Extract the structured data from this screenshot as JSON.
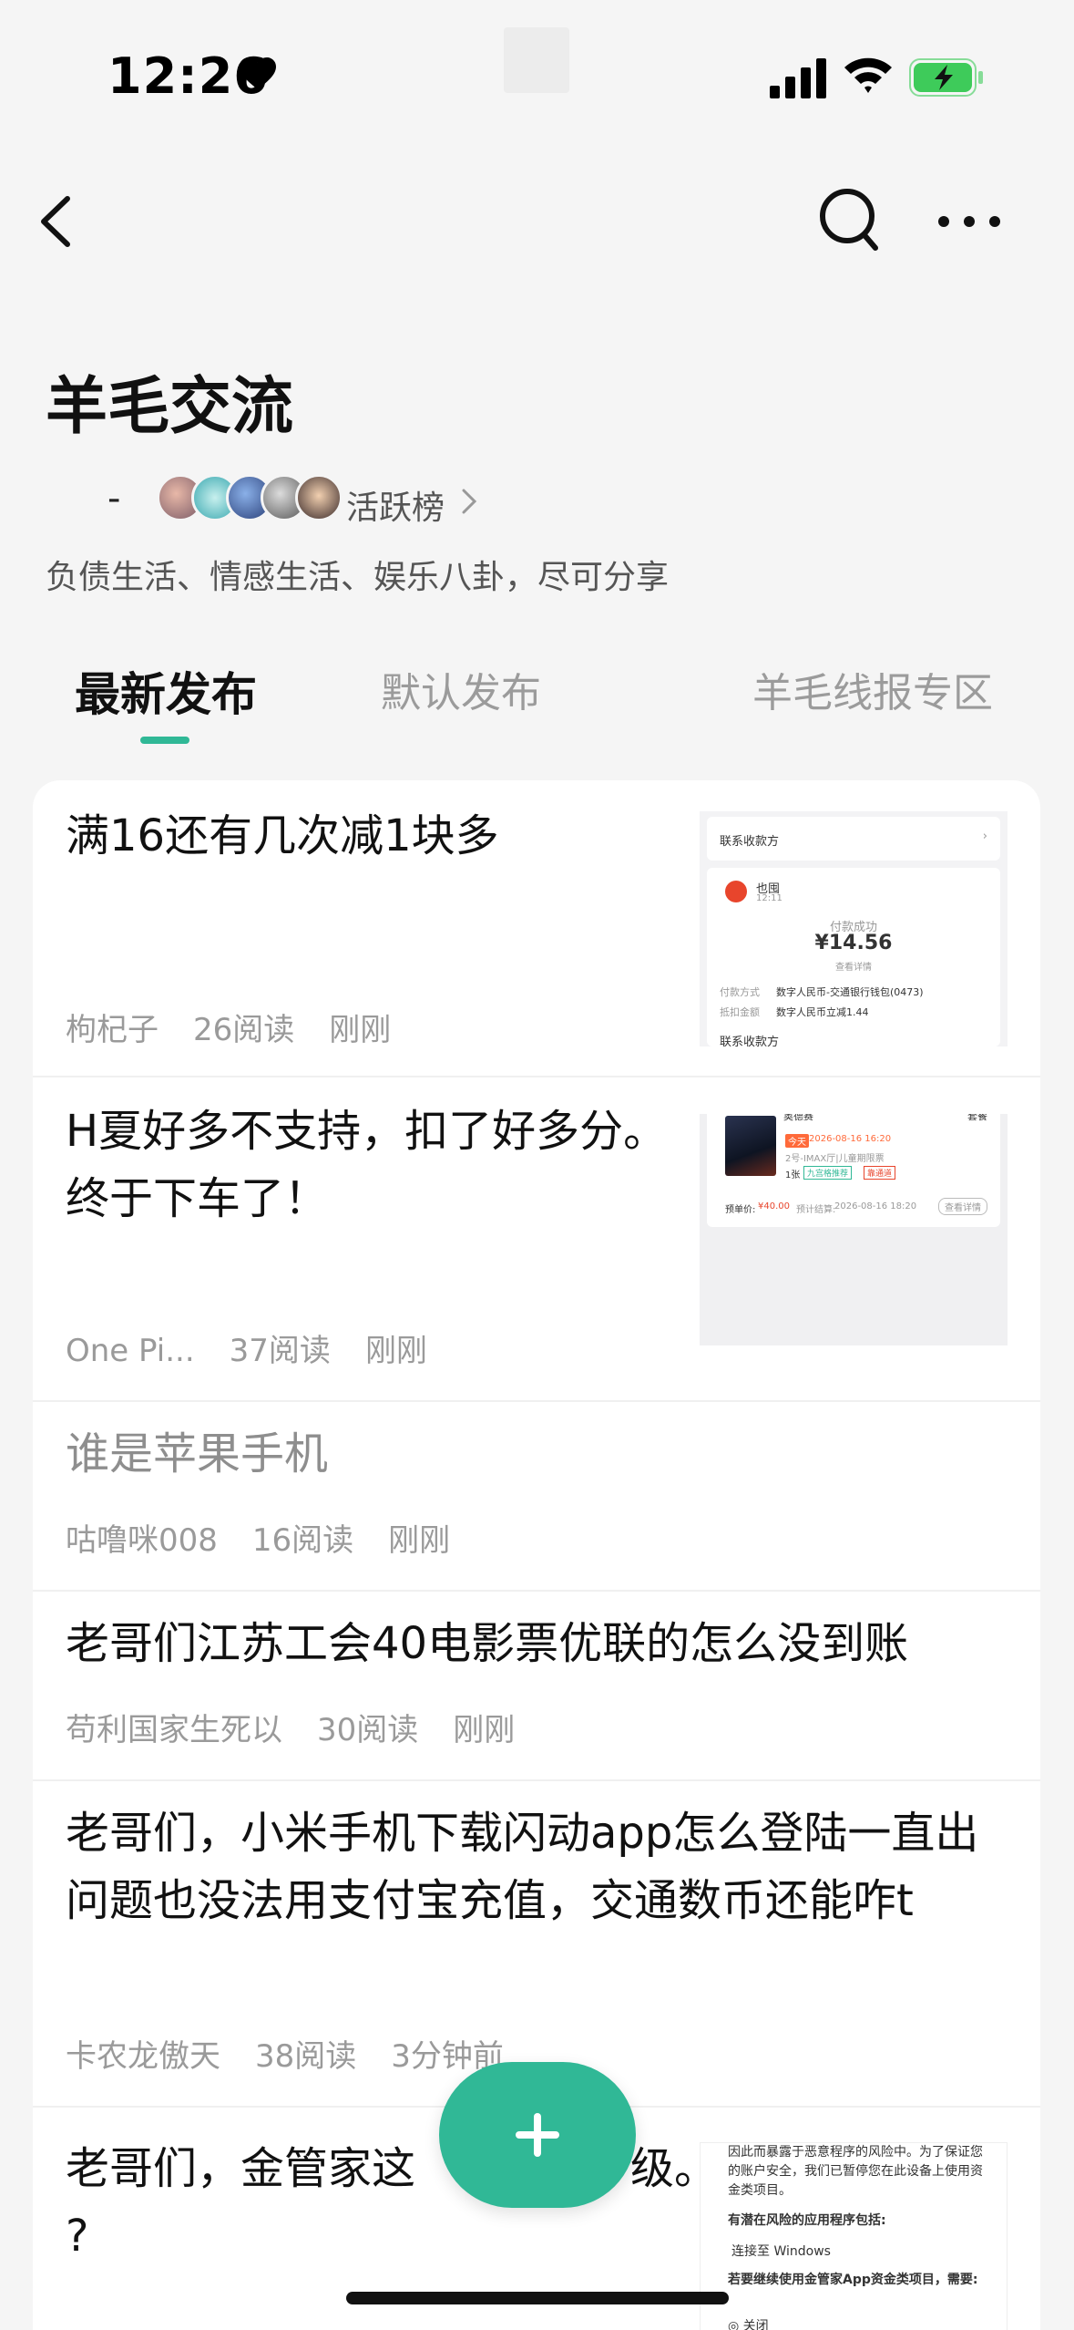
{
  "status_bar": {
    "time": "12:26"
  },
  "header": {
    "title": "羊毛交流",
    "dash": "-",
    "active_label": "活跃榜",
    "description": "负债生活、情感生活、娱乐八卦，尽可分享"
  },
  "tabs": [
    {
      "label": "最新发布",
      "active": true
    },
    {
      "label": "默认发布",
      "active": false
    },
    {
      "label": "羊毛线报专区",
      "active": false
    }
  ],
  "posts": [
    {
      "title": "满16还有几次减1块多",
      "author": "枸杞子",
      "reads": "26阅读",
      "time": "刚刚",
      "thumbnail": {
        "payee_label": "联系收款方",
        "merchant": "也囤",
        "merchant_time": "12:11",
        "status": "付款成功",
        "amount": "¥14.56",
        "detail_link": "查看详情",
        "pay_method_label": "付款方式",
        "pay_method_value": "数字人民币-交通银行钱包(0473)",
        "discount_label": "抵扣金额",
        "discount_value": "数字人民币立减1.44",
        "bottom_label": "联系收款方"
      }
    },
    {
      "title": "H夏好多不支持，扣了好多分。终于下车了！",
      "author": "One Pi...",
      "reads": "37阅读",
      "time": "刚刚",
      "thumbnail": {
        "header_left": "奥德赛",
        "header_right": "套餐",
        "line1_tag": "今天",
        "line1_time": "2026-08-16 16:20",
        "line2": "2号-IMAX厅|儿童期限票",
        "line3_count": "1张",
        "line3_tag1": "九宫格推荐",
        "line3_tag2": "靠通道",
        "price_label": "预单价:",
        "price_value": "¥40.00",
        "expected_label": "预计结算:",
        "expected_value": "2026-08-16 18:20",
        "button": "查看详情"
      }
    },
    {
      "title": "谁是苹果手机",
      "read": true,
      "author": "咕噜咪008",
      "reads": "16阅读",
      "time": "刚刚"
    },
    {
      "title": "老哥们江苏工会40电影票优联的怎么没到账",
      "author": "苟利国家生死以",
      "reads": "30阅读",
      "time": "刚刚"
    },
    {
      "title": "老哥们，小米手机下载闪动app怎么登陆一直出问题也没法用支付宝充值，交通数币还能咋t",
      "author": "卡农龙傲天",
      "reads": "38阅读",
      "time": "3分钟前"
    },
    {
      "title": "老哥们，金管家这",
      "title_tail": "级。",
      "title_line2": "?",
      "thumbnail": {
        "p1": "因此而暴露于恶意程序的风险中。为了保证您的账户安全，我们已暂停您在此设备上使用资金类项目。",
        "h1": "有潜在风险的应用程序包括:",
        "item1": "连接至 Windows",
        "h2": "若要继续使用金管家App资金类项目，需要:",
        "item2": "◎ 关闭"
      }
    }
  ],
  "colors": {
    "accent": "#30b896",
    "background": "#f5f5f5",
    "card": "#ffffff",
    "muted_text": "#9a9a9a",
    "battery_fill": "#3ecb5a"
  },
  "icons": [
    "heart-icon",
    "signal-icon",
    "wifi-icon",
    "battery-charging-icon",
    "back-chevron-icon",
    "search-icon",
    "more-icon",
    "chevron-right-icon",
    "plus-icon"
  ]
}
